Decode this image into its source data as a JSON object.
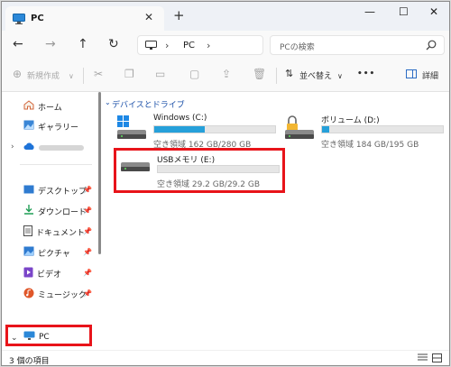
{
  "tab": {
    "title": "PC",
    "close_glyph": "✕"
  },
  "new_tab_glyph": "+",
  "window_controls": {
    "minimize": "—",
    "maximize": "☐",
    "close": "✕"
  },
  "nav": {
    "back": "←",
    "forward": "→",
    "up": "↑",
    "refresh": "↻"
  },
  "address": {
    "sep": "›",
    "crumb": "PC",
    "sep2": "›"
  },
  "search": {
    "placeholder": "PCの検索"
  },
  "commands": {
    "new": "新規作成",
    "sort": "並べ替え",
    "more": "•••",
    "details": "詳細"
  },
  "sidebar": {
    "quick": [
      {
        "label": "ホーム",
        "icon": "home-icon"
      },
      {
        "label": "ギャラリー",
        "icon": "gallery-icon"
      }
    ],
    "cloud_label": "",
    "pinned": [
      {
        "label": "デスクトップ",
        "icon": "desktop-icon"
      },
      {
        "label": "ダウンロード",
        "icon": "download-icon"
      },
      {
        "label": "ドキュメント",
        "icon": "document-icon"
      },
      {
        "label": "ピクチャ",
        "icon": "pictures-icon"
      },
      {
        "label": "ビデオ",
        "icon": "video-icon"
      },
      {
        "label": "ミュージック",
        "icon": "music-icon"
      }
    ],
    "pc_label": "PC"
  },
  "main": {
    "section_title": "デバイスとドライブ",
    "drives": [
      {
        "name": "Windows (C:)",
        "free": "空き領域 162 GB/280 GB",
        "used_fraction": 0.42
      },
      {
        "name": "ボリューム (D:)",
        "free": "空き領域 184 GB/195 GB",
        "used_fraction": 0.06
      },
      {
        "name": "USBメモリ (E:)",
        "free": "空き領域 29.2 GB/29.2 GB",
        "used_fraction": 0.0
      }
    ]
  },
  "status": {
    "count": "3 個の項目"
  },
  "colors": {
    "highlight": "#e8141a",
    "accent": "#26a0da",
    "link": "#1a4fa8"
  }
}
